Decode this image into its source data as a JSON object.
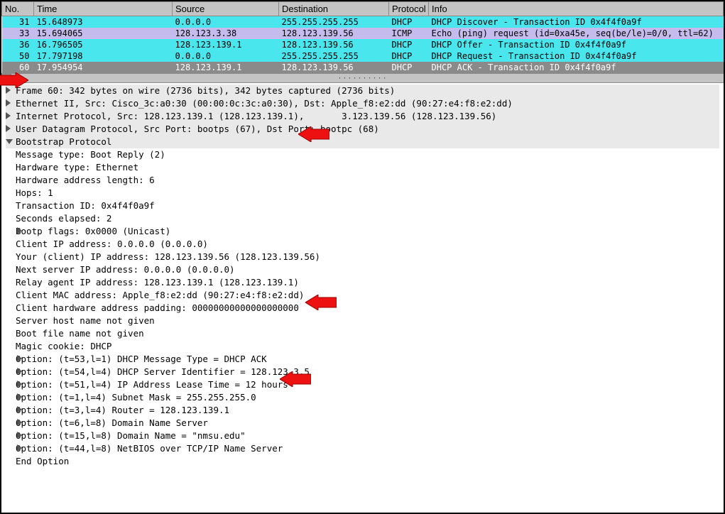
{
  "columns": {
    "no": "No.",
    "time": "Time",
    "source": "Source",
    "destination": "Destination",
    "protocol": "Protocol",
    "info": "Info"
  },
  "packets": [
    {
      "no": "31",
      "time": "15.648973",
      "src": "0.0.0.0",
      "dst": "255.255.255.255",
      "proto": "DHCP",
      "info": "DHCP Discover - Transaction ID 0x4f4f0a9f",
      "cls": "row-cyan"
    },
    {
      "no": "33",
      "time": "15.694065",
      "src": "128.123.3.38",
      "dst": "128.123.139.56",
      "proto": "ICMP",
      "info": "Echo (ping) request  (id=0xa45e, seq(be/le)=0/0, ttl=62)",
      "cls": "row-purple"
    },
    {
      "no": "36",
      "time": "16.796505",
      "src": "128.123.139.1",
      "dst": "128.123.139.56",
      "proto": "DHCP",
      "info": "DHCP Offer    - Transaction ID 0x4f4f0a9f",
      "cls": "row-cyan"
    },
    {
      "no": "50",
      "time": "17.797198",
      "src": "0.0.0.0",
      "dst": "255.255.255.255",
      "proto": "DHCP",
      "info": "DHCP Request  - Transaction ID 0x4f4f0a9f",
      "cls": "row-cyan"
    },
    {
      "no": "60",
      "time": "17.954954",
      "src": "128.123.139.1",
      "dst": "128.123.139.56",
      "proto": "DHCP",
      "info": "DHCP ACK      - Transaction ID 0x4f4f0a9f",
      "cls": "row-selected"
    }
  ],
  "details": {
    "frame": "Frame 60: 342 bytes on wire (2736 bits), 342 bytes captured (2736 bits)",
    "eth": "Ethernet II, Src: Cisco_3c:a0:30 (00:00:0c:3c:a0:30), Dst: Apple_f8:e2:dd (90:27:e4:f8:e2:dd)",
    "ip": "Internet Protocol, Src: 128.123.139.1 (128.123.139.1),       3.123.139.56 (128.123.139.56)",
    "udp": "User Datagram Protocol, Src Port: bootps (67), Dst Port: bootpc (68)",
    "bootp": "Bootstrap Protocol",
    "lines": [
      "Message type: Boot Reply (2)",
      "Hardware type: Ethernet",
      "Hardware address length: 6",
      "Hops: 1",
      "Transaction ID: 0x4f4f0a9f",
      "Seconds elapsed: 2"
    ],
    "flags": "Bootp flags: 0x0000 (Unicast)",
    "lines2": [
      "Client IP address: 0.0.0.0 (0.0.0.0)",
      "Your (client) IP address: 128.123.139.56 (128.123.139.56)",
      "Next server IP address: 0.0.0.0 (0.0.0.0)",
      "Relay agent IP address: 128.123.139.1 (128.123.139.1)",
      "Client MAC address: Apple_f8:e2:dd (90:27:e4:f8:e2:dd)",
      "Client hardware address padding: 00000000000000000000",
      "Server host name not given",
      "Boot file name not given",
      "Magic cookie: DHCP"
    ],
    "options": [
      "Option: (t=53,l=1) DHCP Message Type = DHCP ACK",
      "Option: (t=54,l=4) DHCP Server Identifier = 128.123.3.5",
      "Option: (t=51,l=4) IP Address Lease Time = 12 hours",
      "Option: (t=1,l=4) Subnet Mask = 255.255.255.0",
      "Option: (t=3,l=4) Router = 128.123.139.1",
      "Option: (t=6,l=8) Domain Name Server",
      "Option: (t=15,l=8) Domain Name = \"nmsu.edu\"",
      "Option: (t=44,l=8) NetBIOS over TCP/IP Name Server"
    ],
    "endopt": "End Option"
  }
}
